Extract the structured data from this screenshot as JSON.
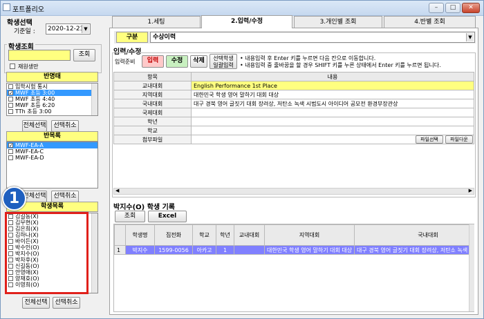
{
  "window": {
    "title": "포트폴리오"
  },
  "left": {
    "student_select_title": "학생선택",
    "base_date_label": "기준일 :",
    "base_date_value": "2020-12-23",
    "student_search_title": "학생조회",
    "search_button": "조회",
    "enrolled_only_label": "재원생만",
    "class_list_header": "반명태",
    "class_items": [
      {
        "label": "입학시험 통시",
        "checked": false,
        "selected": false
      },
      {
        "label": "MWF 초등 3:00",
        "checked": true,
        "selected": true
      },
      {
        "label": "MWF 초등 4:40",
        "checked": false,
        "selected": false
      },
      {
        "label": "MWF 초등 6:20",
        "checked": false,
        "selected": false
      },
      {
        "label": "TTh 초등 3:00",
        "checked": false,
        "selected": false
      }
    ],
    "select_all_1": "전체선택",
    "deselect_1": "선택취소",
    "class_names_header": "반목록",
    "class_names": [
      {
        "label": "MWF-EA-A",
        "checked": true,
        "selected": true
      },
      {
        "label": "MWF-EA-C",
        "checked": false,
        "selected": false
      },
      {
        "label": "MWF-EA-D",
        "checked": false,
        "selected": false
      }
    ],
    "select_all_2": "전체선택",
    "deselect_2": "선택취소",
    "student_list_header": "학생목록",
    "students": [
      "김길동(X)",
      "김무현(X)",
      "김은희(X)",
      "김하나(X)",
      "바이든(X)",
      "박수인(O)",
      "박지수(O)",
      "박차후(X)",
      "신길동(O)",
      "안영애(X)",
      "양재호(O)",
      "이영희(O)"
    ],
    "select_all_3": "전체선택",
    "deselect_3": "선택취소",
    "callout_number": "1"
  },
  "tabs": [
    {
      "label": "1.세팅",
      "active": false
    },
    {
      "label": "2.입력/수정",
      "active": true
    },
    {
      "label": "3.개인별 조회",
      "active": false
    },
    {
      "label": "4.반별 조회",
      "active": false
    }
  ],
  "category": {
    "label": "구분",
    "value": "수상이력"
  },
  "input_section": {
    "title": "입력/수정",
    "prep_label": "입력준비",
    "input_btn": "입력",
    "edit_btn": "수정",
    "delete_btn": "삭제",
    "bulk_btn_line1": "선택학생",
    "bulk_btn_line2": "일괄입력",
    "note1": "• 내용입력 후  Enter 키를 누르면 다음 칸으로 이동합니다.",
    "note2": "• 내용입력 중 줄바꿈을 할 경우 SHIFT 키를 누른  상태에서 Enter 키를 누르면 됩니다.",
    "col_item": "항목",
    "col_content": "내용",
    "rows": [
      {
        "item": "교내대회",
        "content": "English Performance 1st Place"
      },
      {
        "item": "지역대회",
        "content": "대한민국 학생 영어 말하기 대회 대상"
      },
      {
        "item": "국내대회",
        "content": "대구 경북 영어 글짓기 대회 장려상, 저탄소 녹색 시범도시 아이디어 공모전 환경부장관상"
      },
      {
        "item": "국제대회",
        "content": ""
      },
      {
        "item": "학년",
        "content": ""
      },
      {
        "item": "학교",
        "content": ""
      },
      {
        "item": "첨부파일",
        "content": ""
      }
    ],
    "file_select_btn": "파일선택",
    "file_download_btn": "파일다운"
  },
  "record_section": {
    "title": "박지수(O) 학생 기록",
    "search_btn": "조회",
    "excel_btn": "Excel",
    "headers": [
      "",
      "학생명",
      "집전화",
      "학교",
      "학년",
      "교내대회",
      "지역대회",
      "국내대회"
    ],
    "row": [
      "1",
      "박지수",
      "1599-0056",
      "아카고",
      "1",
      "",
      "대한민국 학생 영어 말하기 대회 대상",
      "대구 경북 영어 글짓기 대회 장려상, 저탄소 녹색 시"
    ]
  },
  "colors": {
    "accent_yellow": "#ffff80",
    "selected_blue": "#3399ff",
    "callout_red": "#e0201a",
    "callout_circle": "#1f5fbf",
    "input_btn_red": "#ffc9c9",
    "edit_btn_green": "#c8f0c0"
  }
}
